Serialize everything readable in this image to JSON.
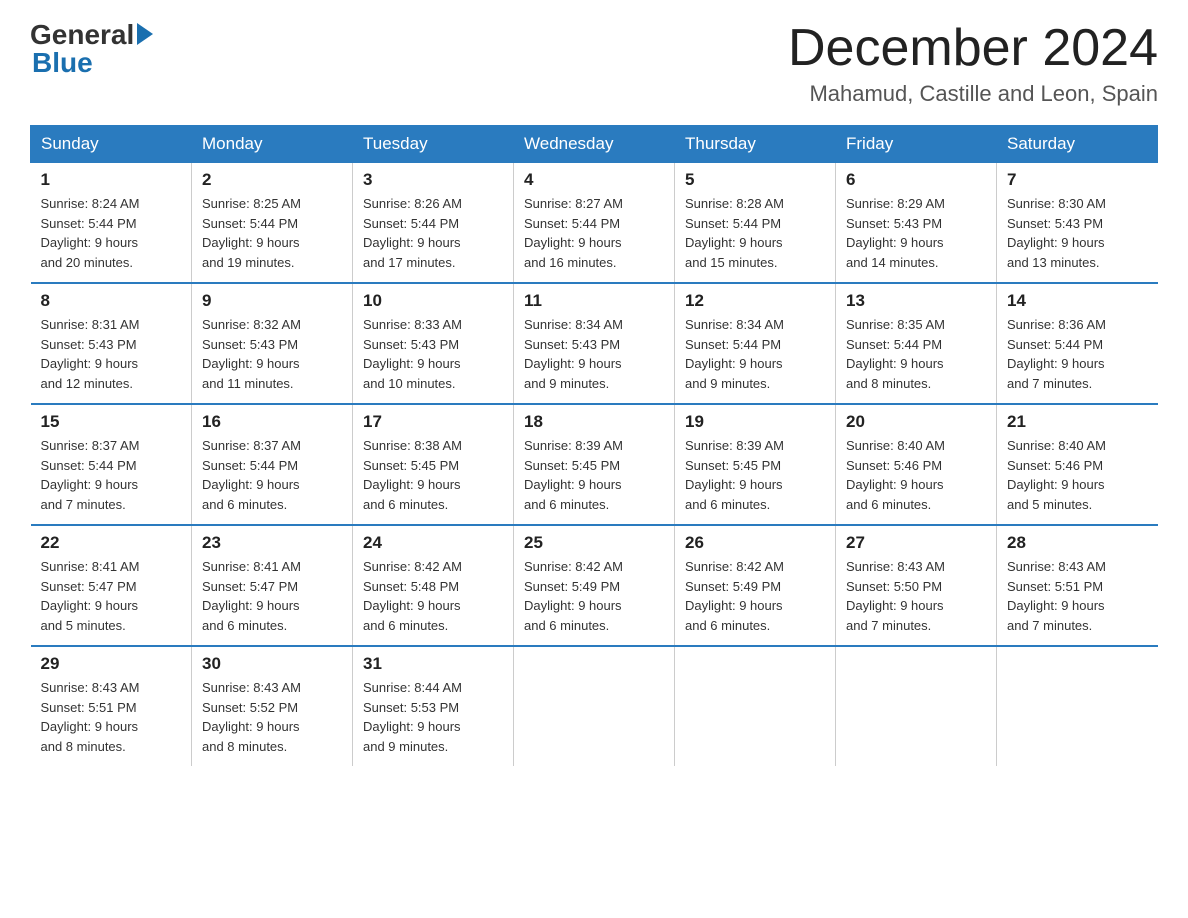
{
  "logo": {
    "general": "General",
    "blue": "Blue"
  },
  "title": {
    "month_year": "December 2024",
    "location": "Mahamud, Castille and Leon, Spain"
  },
  "headers": [
    "Sunday",
    "Monday",
    "Tuesday",
    "Wednesday",
    "Thursday",
    "Friday",
    "Saturday"
  ],
  "weeks": [
    [
      {
        "day": "1",
        "sunrise": "8:24 AM",
        "sunset": "5:44 PM",
        "daylight": "9 hours and 20 minutes."
      },
      {
        "day": "2",
        "sunrise": "8:25 AM",
        "sunset": "5:44 PM",
        "daylight": "9 hours and 19 minutes."
      },
      {
        "day": "3",
        "sunrise": "8:26 AM",
        "sunset": "5:44 PM",
        "daylight": "9 hours and 17 minutes."
      },
      {
        "day": "4",
        "sunrise": "8:27 AM",
        "sunset": "5:44 PM",
        "daylight": "9 hours and 16 minutes."
      },
      {
        "day": "5",
        "sunrise": "8:28 AM",
        "sunset": "5:44 PM",
        "daylight": "9 hours and 15 minutes."
      },
      {
        "day": "6",
        "sunrise": "8:29 AM",
        "sunset": "5:43 PM",
        "daylight": "9 hours and 14 minutes."
      },
      {
        "day": "7",
        "sunrise": "8:30 AM",
        "sunset": "5:43 PM",
        "daylight": "9 hours and 13 minutes."
      }
    ],
    [
      {
        "day": "8",
        "sunrise": "8:31 AM",
        "sunset": "5:43 PM",
        "daylight": "9 hours and 12 minutes."
      },
      {
        "day": "9",
        "sunrise": "8:32 AM",
        "sunset": "5:43 PM",
        "daylight": "9 hours and 11 minutes."
      },
      {
        "day": "10",
        "sunrise": "8:33 AM",
        "sunset": "5:43 PM",
        "daylight": "9 hours and 10 minutes."
      },
      {
        "day": "11",
        "sunrise": "8:34 AM",
        "sunset": "5:43 PM",
        "daylight": "9 hours and 9 minutes."
      },
      {
        "day": "12",
        "sunrise": "8:34 AM",
        "sunset": "5:44 PM",
        "daylight": "9 hours and 9 minutes."
      },
      {
        "day": "13",
        "sunrise": "8:35 AM",
        "sunset": "5:44 PM",
        "daylight": "9 hours and 8 minutes."
      },
      {
        "day": "14",
        "sunrise": "8:36 AM",
        "sunset": "5:44 PM",
        "daylight": "9 hours and 7 minutes."
      }
    ],
    [
      {
        "day": "15",
        "sunrise": "8:37 AM",
        "sunset": "5:44 PM",
        "daylight": "9 hours and 7 minutes."
      },
      {
        "day": "16",
        "sunrise": "8:37 AM",
        "sunset": "5:44 PM",
        "daylight": "9 hours and 6 minutes."
      },
      {
        "day": "17",
        "sunrise": "8:38 AM",
        "sunset": "5:45 PM",
        "daylight": "9 hours and 6 minutes."
      },
      {
        "day": "18",
        "sunrise": "8:39 AM",
        "sunset": "5:45 PM",
        "daylight": "9 hours and 6 minutes."
      },
      {
        "day": "19",
        "sunrise": "8:39 AM",
        "sunset": "5:45 PM",
        "daylight": "9 hours and 6 minutes."
      },
      {
        "day": "20",
        "sunrise": "8:40 AM",
        "sunset": "5:46 PM",
        "daylight": "9 hours and 6 minutes."
      },
      {
        "day": "21",
        "sunrise": "8:40 AM",
        "sunset": "5:46 PM",
        "daylight": "9 hours and 5 minutes."
      }
    ],
    [
      {
        "day": "22",
        "sunrise": "8:41 AM",
        "sunset": "5:47 PM",
        "daylight": "9 hours and 5 minutes."
      },
      {
        "day": "23",
        "sunrise": "8:41 AM",
        "sunset": "5:47 PM",
        "daylight": "9 hours and 6 minutes."
      },
      {
        "day": "24",
        "sunrise": "8:42 AM",
        "sunset": "5:48 PM",
        "daylight": "9 hours and 6 minutes."
      },
      {
        "day": "25",
        "sunrise": "8:42 AM",
        "sunset": "5:49 PM",
        "daylight": "9 hours and 6 minutes."
      },
      {
        "day": "26",
        "sunrise": "8:42 AM",
        "sunset": "5:49 PM",
        "daylight": "9 hours and 6 minutes."
      },
      {
        "day": "27",
        "sunrise": "8:43 AM",
        "sunset": "5:50 PM",
        "daylight": "9 hours and 7 minutes."
      },
      {
        "day": "28",
        "sunrise": "8:43 AM",
        "sunset": "5:51 PM",
        "daylight": "9 hours and 7 minutes."
      }
    ],
    [
      {
        "day": "29",
        "sunrise": "8:43 AM",
        "sunset": "5:51 PM",
        "daylight": "9 hours and 8 minutes."
      },
      {
        "day": "30",
        "sunrise": "8:43 AM",
        "sunset": "5:52 PM",
        "daylight": "9 hours and 8 minutes."
      },
      {
        "day": "31",
        "sunrise": "8:44 AM",
        "sunset": "5:53 PM",
        "daylight": "9 hours and 9 minutes."
      },
      null,
      null,
      null,
      null
    ]
  ],
  "labels": {
    "sunrise": "Sunrise:",
    "sunset": "Sunset:",
    "daylight": "Daylight:"
  }
}
